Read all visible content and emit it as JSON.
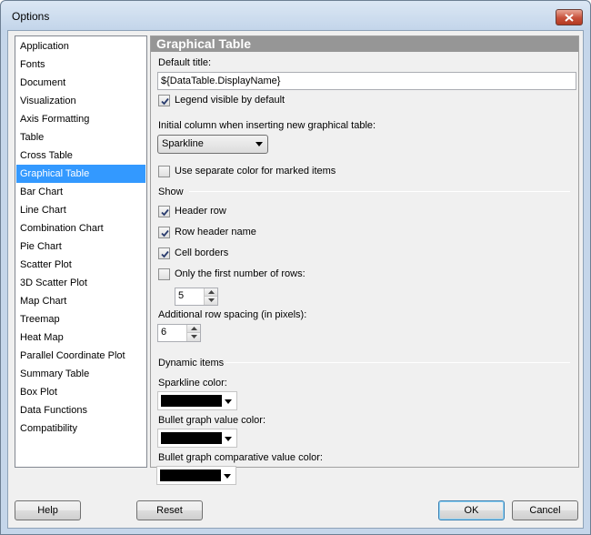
{
  "window": {
    "title": "Options"
  },
  "nav": {
    "items": [
      {
        "label": "Application",
        "selected": false
      },
      {
        "label": "Fonts",
        "selected": false
      },
      {
        "label": "Document",
        "selected": false
      },
      {
        "label": "Visualization",
        "selected": false
      },
      {
        "label": "Axis Formatting",
        "selected": false
      },
      {
        "label": "Table",
        "selected": false
      },
      {
        "label": "Cross Table",
        "selected": false
      },
      {
        "label": "Graphical Table",
        "selected": true
      },
      {
        "label": "Bar Chart",
        "selected": false
      },
      {
        "label": "Line Chart",
        "selected": false
      },
      {
        "label": "Combination Chart",
        "selected": false
      },
      {
        "label": "Pie Chart",
        "selected": false
      },
      {
        "label": "Scatter Plot",
        "selected": false
      },
      {
        "label": "3D Scatter Plot",
        "selected": false
      },
      {
        "label": "Map Chart",
        "selected": false
      },
      {
        "label": "Treemap",
        "selected": false
      },
      {
        "label": "Heat Map",
        "selected": false
      },
      {
        "label": "Parallel Coordinate Plot",
        "selected": false
      },
      {
        "label": "Summary Table",
        "selected": false
      },
      {
        "label": "Box Plot",
        "selected": false
      },
      {
        "label": "Data Functions",
        "selected": false
      },
      {
        "label": "Compatibility",
        "selected": false
      }
    ]
  },
  "panel": {
    "header": "Graphical Table",
    "default_title_label": "Default title:",
    "default_title_value": "${DataTable.DisplayName}",
    "legend_visible_label": "Legend visible by default",
    "legend_visible_checked": true,
    "initial_column_label": "Initial column when inserting new graphical table:",
    "initial_column_value": "Sparkline",
    "separate_color_label": "Use separate color for marked items",
    "separate_color_checked": false,
    "show_group_label": "Show",
    "header_row_label": "Header row",
    "header_row_checked": true,
    "row_header_name_label": "Row header name",
    "row_header_name_checked": true,
    "cell_borders_label": "Cell borders",
    "cell_borders_checked": true,
    "first_rows_label": "Only the first number of rows:",
    "first_rows_checked": false,
    "first_rows_value": "5",
    "row_spacing_label": "Additional row spacing (in pixels):",
    "row_spacing_value": "6",
    "dynamic_group_label": "Dynamic items",
    "sparkline_color_label": "Sparkline color:",
    "sparkline_color": "#000000",
    "bullet_value_color_label": "Bullet graph value color:",
    "bullet_value_color": "#000000",
    "bullet_comparative_color_label": "Bullet graph comparative value color:",
    "bullet_comparative_color": "#000000"
  },
  "footer": {
    "help_label": "Help",
    "reset_label": "Reset",
    "ok_label": "OK",
    "cancel_label": "Cancel"
  }
}
